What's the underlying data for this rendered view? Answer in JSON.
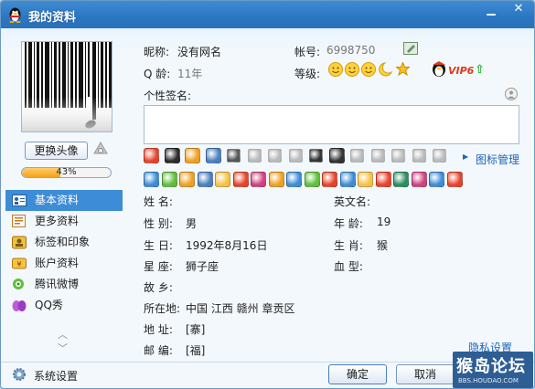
{
  "window": {
    "title": "我的资料",
    "minimize_icon": "minimize-icon",
    "close_icon": "close-icon"
  },
  "sidebar": {
    "change_avatar_label": "更换头像",
    "progress_text": "43%",
    "progress_value": 0.43,
    "items": [
      {
        "label": "基本资料",
        "icon": "profile-card-icon",
        "active": true
      },
      {
        "label": "更多资料",
        "icon": "document-icon",
        "active": false
      },
      {
        "label": "标签和印象",
        "icon": "tag-icon",
        "active": false
      },
      {
        "label": "账户资料",
        "icon": "wallet-icon",
        "active": false
      },
      {
        "label": "腾讯微博",
        "icon": "weibo-icon",
        "active": false
      },
      {
        "label": "QQ秀",
        "icon": "qqshow-icon",
        "active": false
      }
    ],
    "system_settings_label": "系统设置"
  },
  "profile": {
    "nickname_label": "昵称:",
    "nickname_value": "没有网名",
    "account_label": "帐号:",
    "account_value": "6998750",
    "age_label": "Q 龄:",
    "age_value": "11年",
    "level_label": "等级:",
    "vip_text": "VIP6",
    "signature_label": "个性签名:"
  },
  "icon_manage_label": "图标管理",
  "details": {
    "name_label": "姓  名:",
    "english_name_label": "英文名:",
    "gender_label": "性  别:",
    "gender_value": "男",
    "age_label": "年  龄:",
    "age_value": "19",
    "birthday_label": "生  日:",
    "birthday_value": "1992年8月16日",
    "zodiac_label": "生  肖:",
    "zodiac_value": "猴",
    "constellation_label": "星  座:",
    "constellation_value": "狮子座",
    "blood_label": "血  型:",
    "hometown_label": "故  乡:",
    "location_label": "所在地:",
    "location_value": "中国  江西  赣州  章贡区",
    "address_label": "地  址:",
    "address_value": "[寨]",
    "postcode_label": "邮  编:",
    "postcode_value": "[福]"
  },
  "privacy_label": "隐私设置",
  "buttons": {
    "ok": "确定",
    "cancel": "取消"
  },
  "watermark": {
    "main": "猴岛论坛",
    "sub": "BBS.HOUDAO.COM"
  },
  "colors": {
    "titlebar": "#2b76c2",
    "accent": "#3c8cd7",
    "link": "#1d63b8",
    "vip": "#e03a1a"
  }
}
